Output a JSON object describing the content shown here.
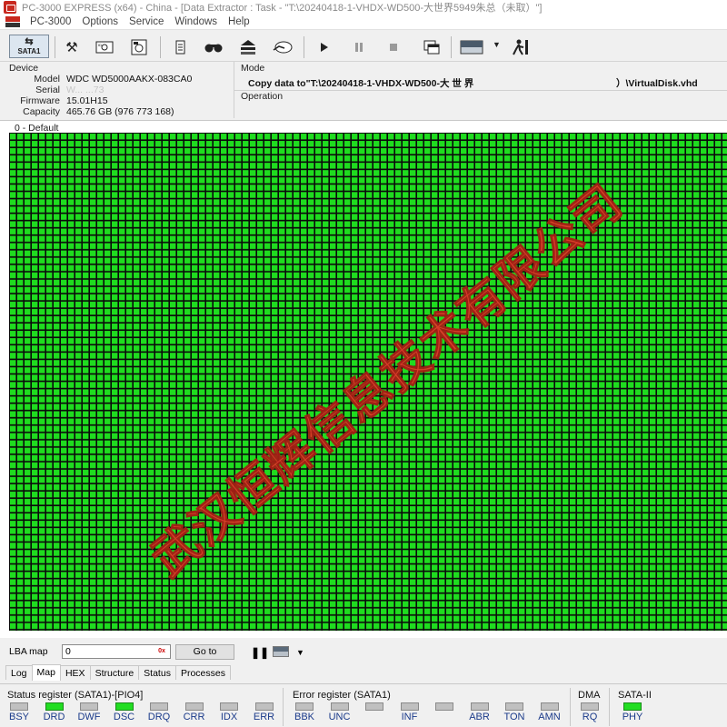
{
  "window": {
    "title": "PC-3000 EXPRESS (x64) - China - [Data Extractor : Task - \"T:\\20240418-1-VHDX-WD500-大世界5949朱总（未取）\"]"
  },
  "menu": [
    "PC-3000",
    "Options",
    "Service",
    "Windows",
    "Help"
  ],
  "toolbar": {
    "sata_label": "SATA1",
    "icons": [
      "sata-port-icon",
      "tools-icon",
      "drive-id-icon",
      "drive-settings-icon",
      "task-icon",
      "search-icon",
      "disk-stack-icon",
      "hand-drive-icon",
      "play-icon",
      "pause-icon",
      "stop-icon",
      "copy-windows-icon",
      "view-mode-icon",
      "exit-icon"
    ]
  },
  "device": {
    "header": "Device",
    "rows": [
      {
        "label": "Model",
        "value": "WDC WD5000AAKX-083CA0"
      },
      {
        "label": "Serial",
        "value": "W... ...73"
      },
      {
        "label": "Firmware",
        "value": "15.01H15"
      },
      {
        "label": "Capacity",
        "value": "465.76 GB (976 773 168)"
      }
    ]
  },
  "mode": {
    "header": "Mode",
    "text": "Copy data to\"T:\\20240418-1-VHDX-WD500-大 世 界",
    "tail": "）\\VirtualDisk.vhd",
    "operation_header": "Operation"
  },
  "map": {
    "label": "0 - Default",
    "cell_color": "#1fdc1f",
    "watermark": "武汉恒辉信息技术有限公司"
  },
  "lba": {
    "label": "LBA map",
    "value": "0",
    "hex_badge": "0x",
    "goto_label": "Go to"
  },
  "tabs": [
    {
      "label": "Log",
      "active": false
    },
    {
      "label": "Map",
      "active": true
    },
    {
      "label": "HEX",
      "active": false
    },
    {
      "label": "Structure",
      "active": false
    },
    {
      "label": "Status",
      "active": false
    },
    {
      "label": "Processes",
      "active": false
    }
  ],
  "registers": {
    "status_title": "Status register (SATA1)-[PIO4]",
    "status_leds": [
      {
        "label": "BSY",
        "on": false
      },
      {
        "label": "DRD",
        "on": true
      },
      {
        "label": "DWF",
        "on": false
      },
      {
        "label": "DSC",
        "on": true
      },
      {
        "label": "DRQ",
        "on": false
      },
      {
        "label": "CRR",
        "on": false
      },
      {
        "label": "IDX",
        "on": false
      },
      {
        "label": "ERR",
        "on": false
      }
    ],
    "error_title": "Error register (SATA1)",
    "error_leds": [
      {
        "label": "BBK",
        "on": false
      },
      {
        "label": "UNC",
        "on": false
      },
      {
        "label": "",
        "on": false
      },
      {
        "label": "INF",
        "on": false
      },
      {
        "label": "",
        "on": false
      },
      {
        "label": "ABR",
        "on": false
      },
      {
        "label": "TON",
        "on": false
      },
      {
        "label": "AMN",
        "on": false
      }
    ],
    "dma_title": "DMA",
    "dma_leds": [
      {
        "label": "RQ",
        "on": false
      }
    ],
    "sata_title": "SATA-II",
    "sata_leds": [
      {
        "label": "PHY",
        "on": true
      }
    ]
  }
}
